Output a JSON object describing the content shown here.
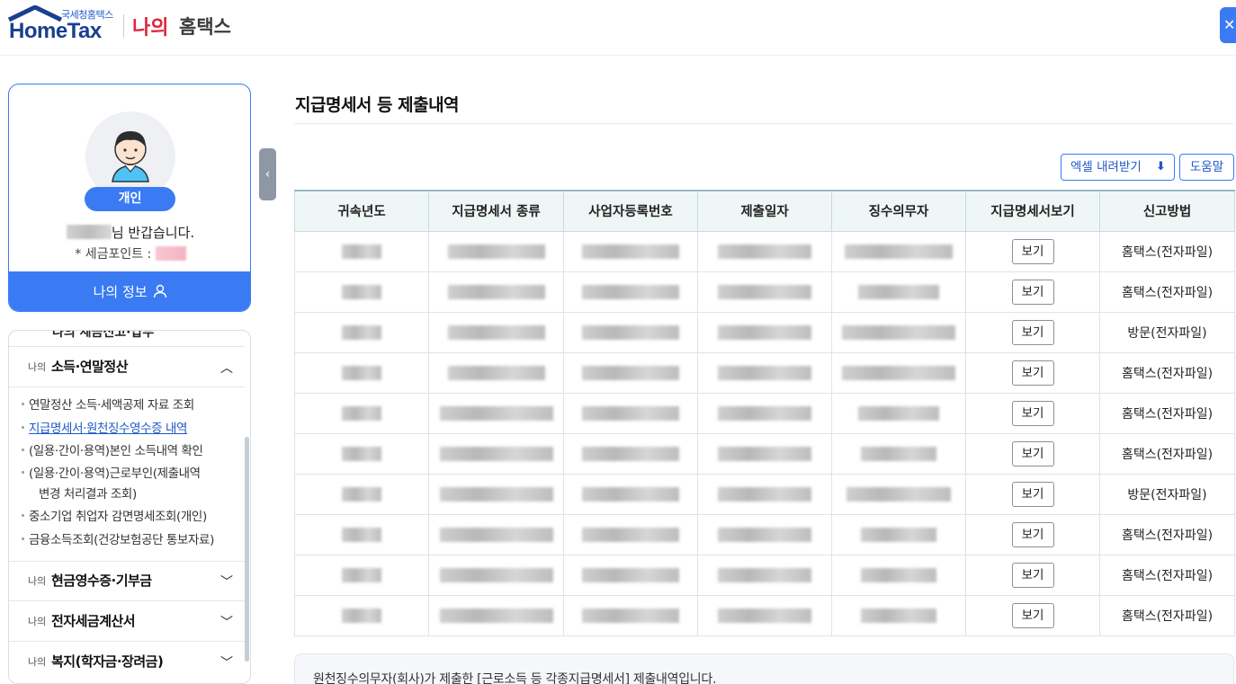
{
  "header": {
    "logo_small": "국세청홈택스",
    "logo_main": "HomeTax",
    "my_label": "나의",
    "service_label": "홈택스",
    "menu_icon": "close-icon"
  },
  "profile": {
    "badge": "개인",
    "greeting_suffix": "님 반갑습니다.",
    "points_label": "* 세금포인트 :",
    "my_info_label": "나의 정보",
    "my_info_icon": "user-icon"
  },
  "sidebar": {
    "accent_color": "#3a7bf3",
    "sections": [
      {
        "prefix": "나의",
        "title": "소득·연말정산",
        "expanded": true
      },
      {
        "prefix": "나의",
        "title": "현금영수증·기부금",
        "expanded": false
      },
      {
        "prefix": "나의",
        "title": "전자세금계산서",
        "expanded": false
      },
      {
        "prefix": "나의",
        "title": "복지(학자금·장려금)",
        "expanded": false
      }
    ],
    "sub_items": [
      "연말정산 소득·세액공제 자료 조회",
      "지급명세서·원천징수영수증 내역",
      "(일용·간이·용역)본인 소득내역 확인",
      "(일용·간이·용역)근로부인(제출내역",
      "변경 처리결과 조회)",
      "중소기업 취업자 감면명세조회(개인)",
      "금융소득조회(건강보험공단 통보자료)"
    ]
  },
  "main": {
    "title": "지급명세서 등 제출내역",
    "excel_button": "엑셀 내려받기",
    "help_button": "도움말",
    "columns": [
      "귀속년도",
      "지급명세서 종류",
      "사업자등록번호",
      "제출일자",
      "징수의무자",
      "지급명세서보기",
      "신고방법"
    ],
    "view_label": "보기",
    "rows": [
      {
        "method": "홈택스(전자파일)"
      },
      {
        "method": "홈택스(전자파일)"
      },
      {
        "method": "방문(전자파일)"
      },
      {
        "method": "홈택스(전자파일)"
      },
      {
        "method": "홈택스(전자파일)"
      },
      {
        "method": "홈택스(전자파일)"
      },
      {
        "method": "방문(전자파일)"
      },
      {
        "method": "홈택스(전자파일)"
      },
      {
        "method": "홈택스(전자파일)"
      },
      {
        "method": "홈택스(전자파일)"
      }
    ],
    "notice": "원천징수의무자(회사)가 제출한 [근로소득 등 각종지급명세서] 제출내역입니다."
  }
}
